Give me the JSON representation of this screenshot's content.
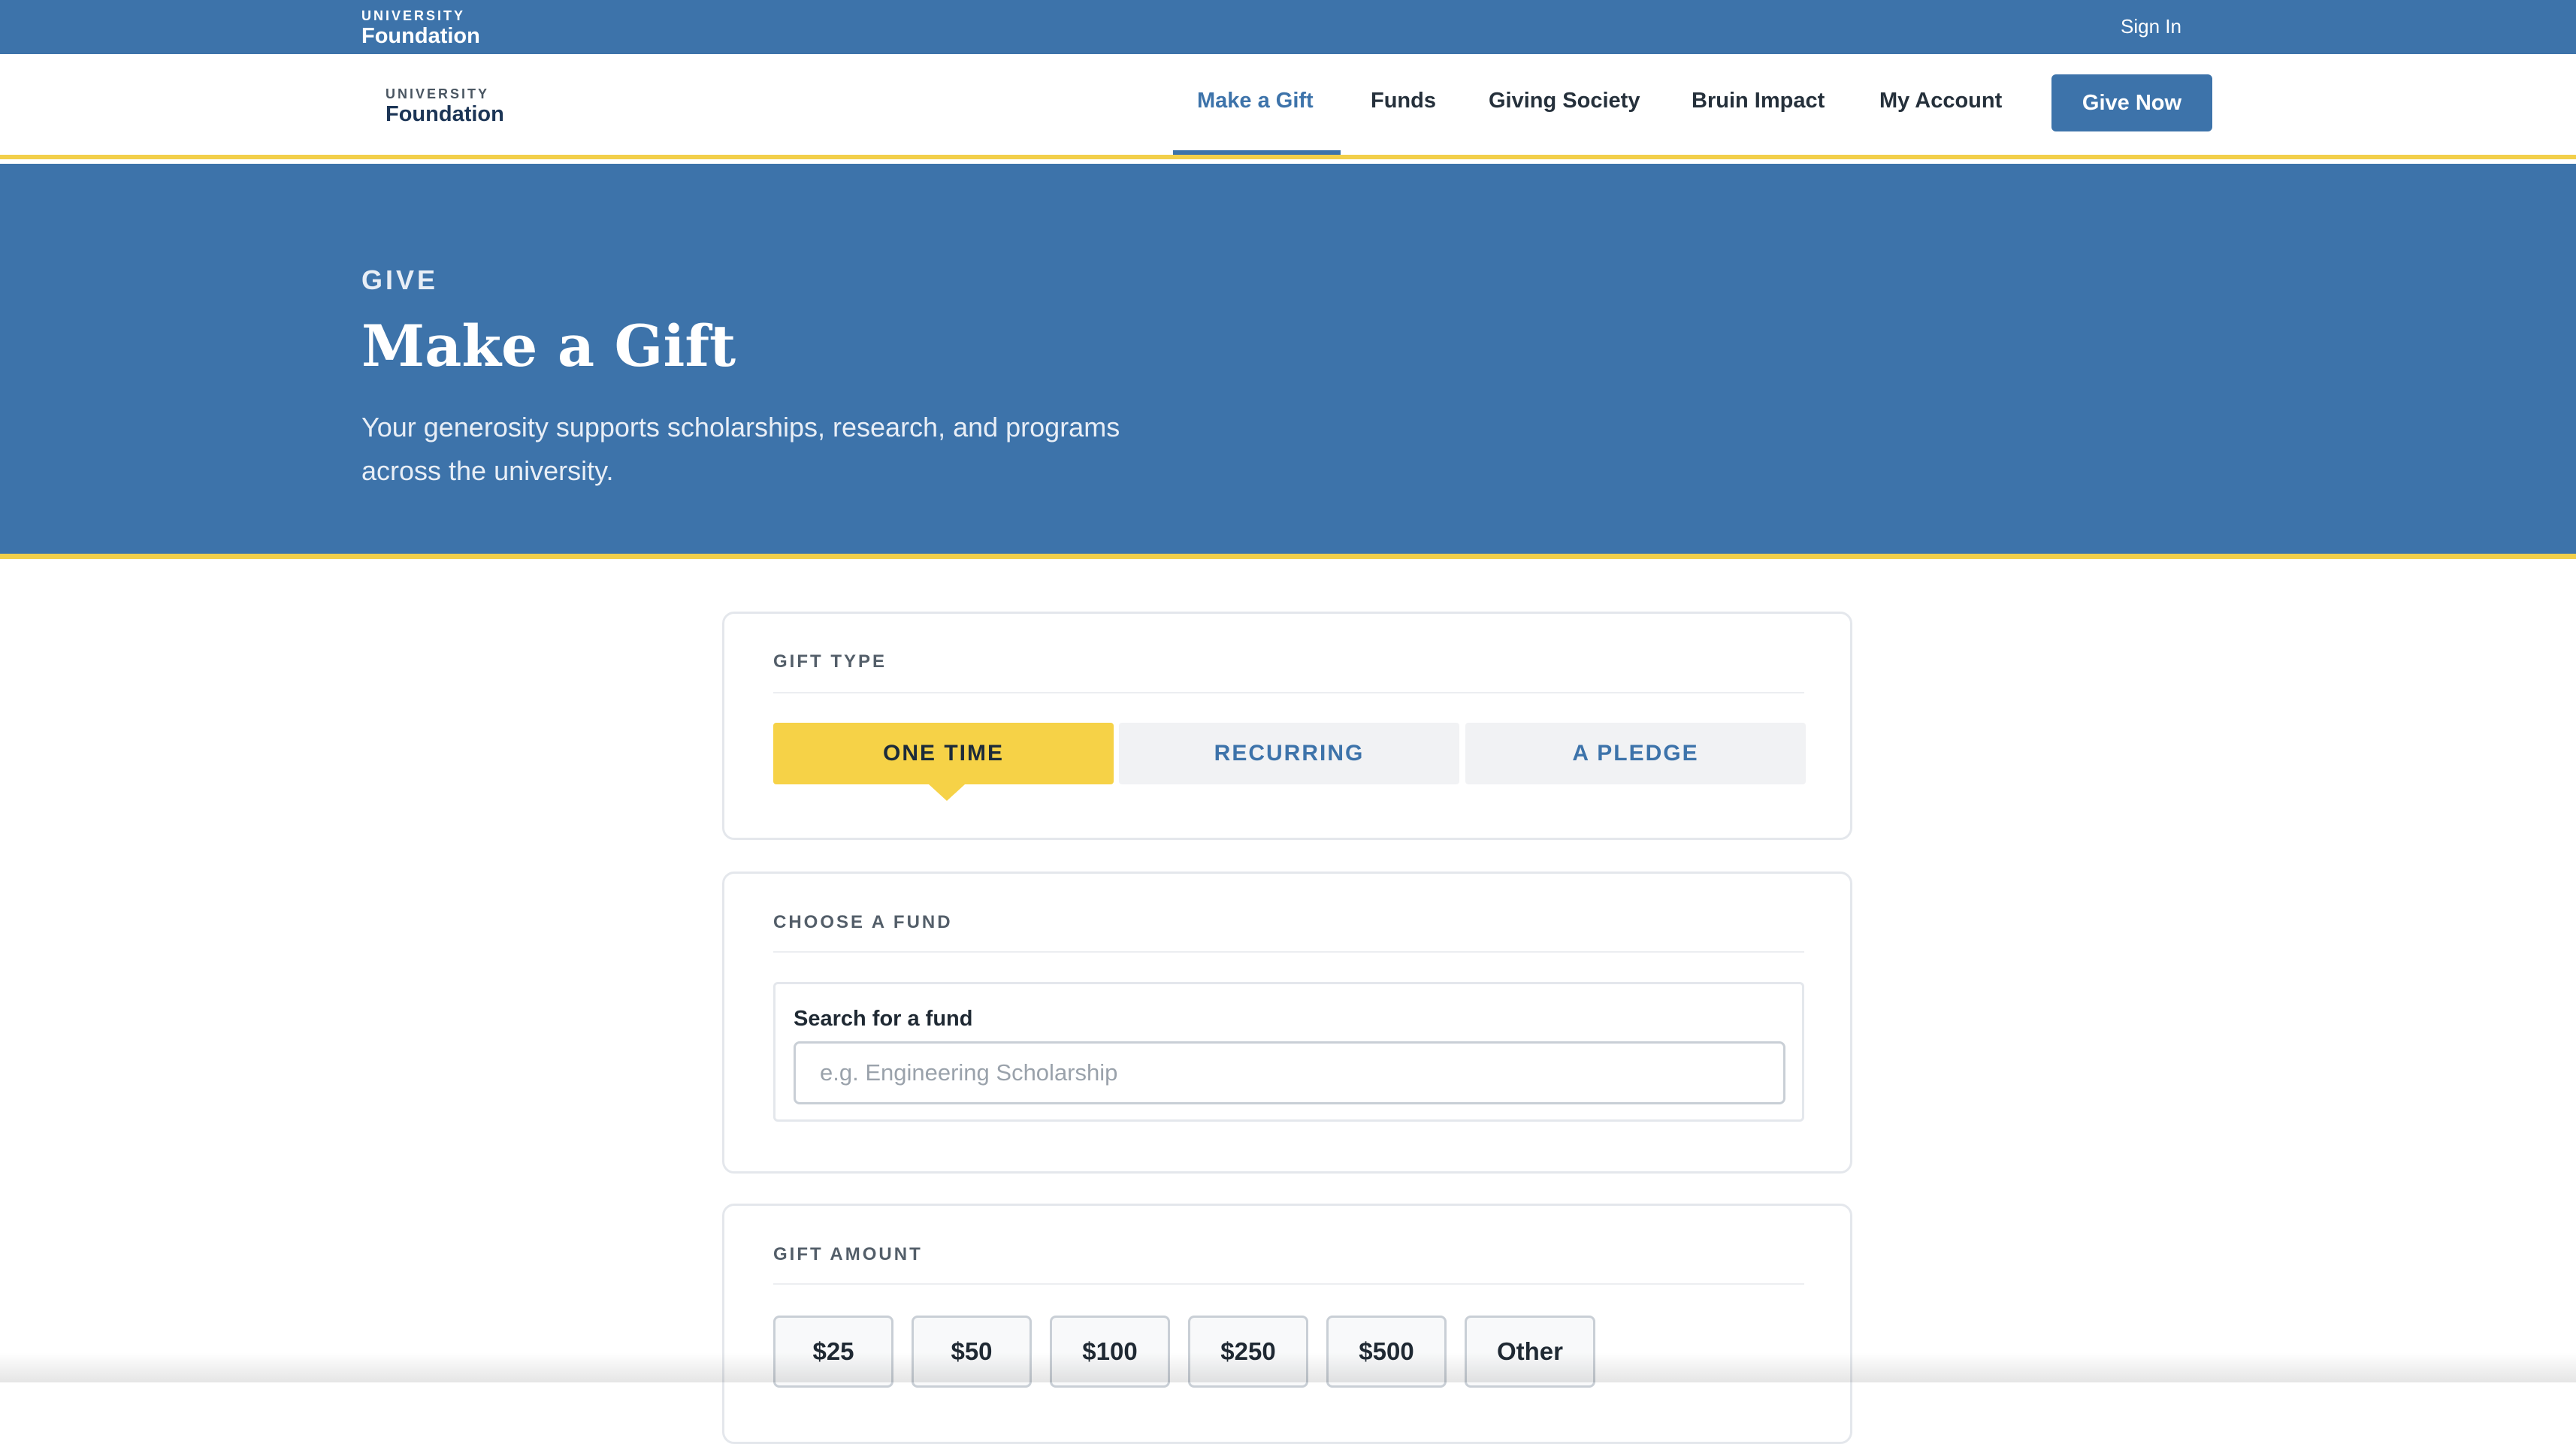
{
  "topbar": {
    "logo_small": "UNIVERSITY",
    "logo_big": "Foundation",
    "signin_label": "Sign In"
  },
  "mainnav": {
    "logo_small": "UNIVERSITY",
    "logo_big": "Foundation",
    "items": [
      {
        "label": "Make a Gift",
        "active": true
      },
      {
        "label": "Funds"
      },
      {
        "label": "Giving Society"
      },
      {
        "label": "Bruin Impact"
      },
      {
        "label": "My Account"
      }
    ],
    "cta_label": "Give Now"
  },
  "hero": {
    "eyebrow": "GIVE",
    "title": "Make a Gift",
    "subtitle": "Your generosity supports scholarships, research, and programs across the university."
  },
  "gift_type": {
    "label": "GIFT TYPE",
    "options": [
      "ONE TIME",
      "RECURRING",
      "A PLEDGE"
    ],
    "selected": "ONE TIME"
  },
  "fund": {
    "label": "CHOOSE A FUND",
    "search_label": "Search for a fund",
    "search_placeholder": "e.g. Engineering Scholarship",
    "search_value": ""
  },
  "amount": {
    "label": "GIFT AMOUNT",
    "options": [
      "$25",
      "$50",
      "$100",
      "$250",
      "$500",
      "Other"
    ]
  },
  "colors": {
    "brand_blue": "#3d73aa",
    "accent_gold": "#f6d247"
  }
}
